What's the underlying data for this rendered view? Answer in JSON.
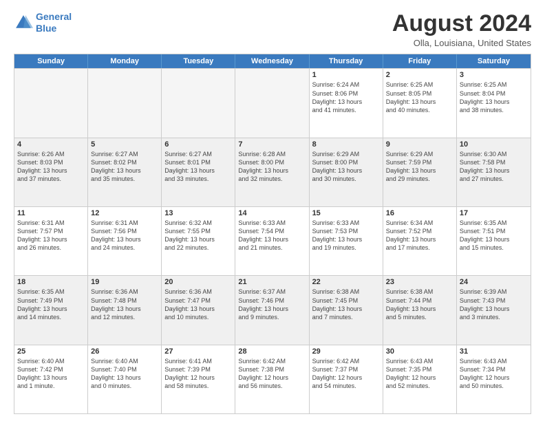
{
  "logo": {
    "line1": "General",
    "line2": "Blue"
  },
  "title": "August 2024",
  "location": "Olla, Louisiana, United States",
  "days": [
    "Sunday",
    "Monday",
    "Tuesday",
    "Wednesday",
    "Thursday",
    "Friday",
    "Saturday"
  ],
  "rows": [
    [
      {
        "day": "",
        "info": "",
        "empty": true
      },
      {
        "day": "",
        "info": "",
        "empty": true
      },
      {
        "day": "",
        "info": "",
        "empty": true
      },
      {
        "day": "",
        "info": "",
        "empty": true
      },
      {
        "day": "1",
        "info": "Sunrise: 6:24 AM\nSunset: 8:06 PM\nDaylight: 13 hours\nand 41 minutes."
      },
      {
        "day": "2",
        "info": "Sunrise: 6:25 AM\nSunset: 8:05 PM\nDaylight: 13 hours\nand 40 minutes."
      },
      {
        "day": "3",
        "info": "Sunrise: 6:25 AM\nSunset: 8:04 PM\nDaylight: 13 hours\nand 38 minutes."
      }
    ],
    [
      {
        "day": "4",
        "info": "Sunrise: 6:26 AM\nSunset: 8:03 PM\nDaylight: 13 hours\nand 37 minutes.",
        "shaded": true
      },
      {
        "day": "5",
        "info": "Sunrise: 6:27 AM\nSunset: 8:02 PM\nDaylight: 13 hours\nand 35 minutes.",
        "shaded": true
      },
      {
        "day": "6",
        "info": "Sunrise: 6:27 AM\nSunset: 8:01 PM\nDaylight: 13 hours\nand 33 minutes.",
        "shaded": true
      },
      {
        "day": "7",
        "info": "Sunrise: 6:28 AM\nSunset: 8:00 PM\nDaylight: 13 hours\nand 32 minutes.",
        "shaded": true
      },
      {
        "day": "8",
        "info": "Sunrise: 6:29 AM\nSunset: 8:00 PM\nDaylight: 13 hours\nand 30 minutes.",
        "shaded": true
      },
      {
        "day": "9",
        "info": "Sunrise: 6:29 AM\nSunset: 7:59 PM\nDaylight: 13 hours\nand 29 minutes.",
        "shaded": true
      },
      {
        "day": "10",
        "info": "Sunrise: 6:30 AM\nSunset: 7:58 PM\nDaylight: 13 hours\nand 27 minutes.",
        "shaded": true
      }
    ],
    [
      {
        "day": "11",
        "info": "Sunrise: 6:31 AM\nSunset: 7:57 PM\nDaylight: 13 hours\nand 26 minutes."
      },
      {
        "day": "12",
        "info": "Sunrise: 6:31 AM\nSunset: 7:56 PM\nDaylight: 13 hours\nand 24 minutes."
      },
      {
        "day": "13",
        "info": "Sunrise: 6:32 AM\nSunset: 7:55 PM\nDaylight: 13 hours\nand 22 minutes."
      },
      {
        "day": "14",
        "info": "Sunrise: 6:33 AM\nSunset: 7:54 PM\nDaylight: 13 hours\nand 21 minutes."
      },
      {
        "day": "15",
        "info": "Sunrise: 6:33 AM\nSunset: 7:53 PM\nDaylight: 13 hours\nand 19 minutes."
      },
      {
        "day": "16",
        "info": "Sunrise: 6:34 AM\nSunset: 7:52 PM\nDaylight: 13 hours\nand 17 minutes."
      },
      {
        "day": "17",
        "info": "Sunrise: 6:35 AM\nSunset: 7:51 PM\nDaylight: 13 hours\nand 15 minutes."
      }
    ],
    [
      {
        "day": "18",
        "info": "Sunrise: 6:35 AM\nSunset: 7:49 PM\nDaylight: 13 hours\nand 14 minutes.",
        "shaded": true
      },
      {
        "day": "19",
        "info": "Sunrise: 6:36 AM\nSunset: 7:48 PM\nDaylight: 13 hours\nand 12 minutes.",
        "shaded": true
      },
      {
        "day": "20",
        "info": "Sunrise: 6:36 AM\nSunset: 7:47 PM\nDaylight: 13 hours\nand 10 minutes.",
        "shaded": true
      },
      {
        "day": "21",
        "info": "Sunrise: 6:37 AM\nSunset: 7:46 PM\nDaylight: 13 hours\nand 9 minutes.",
        "shaded": true
      },
      {
        "day": "22",
        "info": "Sunrise: 6:38 AM\nSunset: 7:45 PM\nDaylight: 13 hours\nand 7 minutes.",
        "shaded": true
      },
      {
        "day": "23",
        "info": "Sunrise: 6:38 AM\nSunset: 7:44 PM\nDaylight: 13 hours\nand 5 minutes.",
        "shaded": true
      },
      {
        "day": "24",
        "info": "Sunrise: 6:39 AM\nSunset: 7:43 PM\nDaylight: 13 hours\nand 3 minutes.",
        "shaded": true
      }
    ],
    [
      {
        "day": "25",
        "info": "Sunrise: 6:40 AM\nSunset: 7:42 PM\nDaylight: 13 hours\nand 1 minute."
      },
      {
        "day": "26",
        "info": "Sunrise: 6:40 AM\nSunset: 7:40 PM\nDaylight: 13 hours\nand 0 minutes."
      },
      {
        "day": "27",
        "info": "Sunrise: 6:41 AM\nSunset: 7:39 PM\nDaylight: 12 hours\nand 58 minutes."
      },
      {
        "day": "28",
        "info": "Sunrise: 6:42 AM\nSunset: 7:38 PM\nDaylight: 12 hours\nand 56 minutes."
      },
      {
        "day": "29",
        "info": "Sunrise: 6:42 AM\nSunset: 7:37 PM\nDaylight: 12 hours\nand 54 minutes."
      },
      {
        "day": "30",
        "info": "Sunrise: 6:43 AM\nSunset: 7:35 PM\nDaylight: 12 hours\nand 52 minutes."
      },
      {
        "day": "31",
        "info": "Sunrise: 6:43 AM\nSunset: 7:34 PM\nDaylight: 12 hours\nand 50 minutes."
      }
    ]
  ]
}
